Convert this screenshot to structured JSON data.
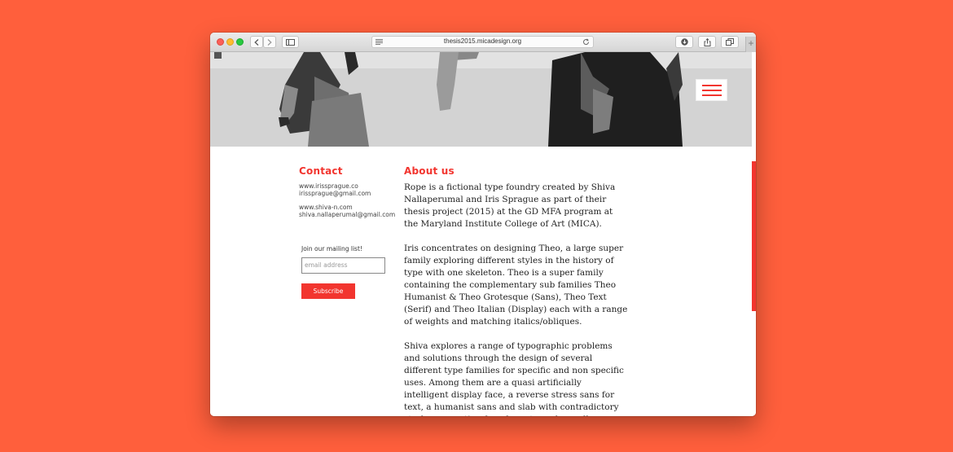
{
  "browser": {
    "url": "thesis2015.micadesign.org",
    "new_tab_symbol": "+",
    "icons": [
      "back-chevron-icon",
      "forward-chevron-icon",
      "sidebar-icon",
      "reader-icon",
      "reload-icon",
      "download-icon",
      "share-icon",
      "tabs-icon",
      "plus-icon"
    ]
  },
  "hero": {
    "menu_icon": "hamburger-menu-icon"
  },
  "contact": {
    "heading": "Contact",
    "site1": "www.irissprague.co",
    "email1": "irissprague@gmail.com",
    "site2": "www.shiva-n.com",
    "email2": "shiva.nallaperumal@gmail.com",
    "mailing_label": "Join our mailing list!",
    "email_placeholder": "email address",
    "subscribe_label": "Subscribe"
  },
  "about": {
    "heading": "About us",
    "paragraph1": "Rope is a fictional type foundry created by Shiva Nallaperumal and Iris Sprague as part of their thesis project (2015) at the GD MFA program at the Maryland Institute College of Art (MICA).",
    "paragraph2": "Iris concentrates on designing Theo, a large super family exploring different styles in the history of type with one skeleton. Theo is a super family containing the complementary sub families Theo Humanist & Theo Grotesque (Sans), Theo Text (Serif) and Theo Italian (Display) each with a range of weights and matching italics/obliques.",
    "paragraph3": "Shiva explores a range of typographic problems and solutions through the design of several different type families for specific and non specific uses. Among them are a quasi artificially intelligent display face, a reverse stress sans for text, a humanist sans and slab with contradictory strokes, a caption face for extremely small"
  },
  "colors": {
    "background": "#ff5f3c",
    "accent": "#f2352f"
  }
}
